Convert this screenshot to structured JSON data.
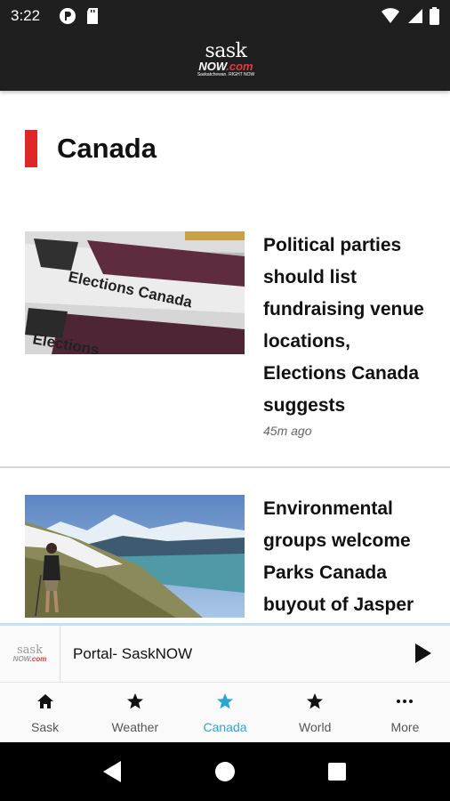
{
  "status_bar": {
    "time": "3:22",
    "left_icons": [
      "notification-icon",
      "sd-card-icon"
    ],
    "right_icons": [
      "wifi-icon",
      "signal-icon",
      "battery-icon"
    ]
  },
  "header": {
    "logo": {
      "top": "sask",
      "mid": "NOW",
      "mid_suffix": ".com",
      "sub": "Saskatchewan. RIGHT NOW"
    }
  },
  "section": {
    "title": "Canada",
    "accent_color": "#e02727"
  },
  "articles": [
    {
      "headline": "Political parties should list fundraising venue locations, Elections Canada suggests",
      "timestamp": "45m ago",
      "image": "elections-canada-photo"
    },
    {
      "headline": "Environmental groups welcome Parks Canada buyout of Jasper",
      "image": "jasper-hiker-photo"
    }
  ],
  "player": {
    "logo": {
      "top": "sask",
      "mid": "NOW",
      "mid_suffix": ".com"
    },
    "title": "Portal- SaskNOW",
    "play_icon": "play-icon"
  },
  "tabs": [
    {
      "label": "Sask",
      "icon": "home-icon",
      "active": false
    },
    {
      "label": "Weather",
      "icon": "star-icon",
      "active": false
    },
    {
      "label": "Canada",
      "icon": "star-icon",
      "active": true
    },
    {
      "label": "World",
      "icon": "star-icon",
      "active": false
    },
    {
      "label": "More",
      "icon": "more-icon",
      "active": false
    }
  ],
  "colors": {
    "active_tab": "#2ba7d6",
    "header_bg": "#1f1f1f"
  }
}
